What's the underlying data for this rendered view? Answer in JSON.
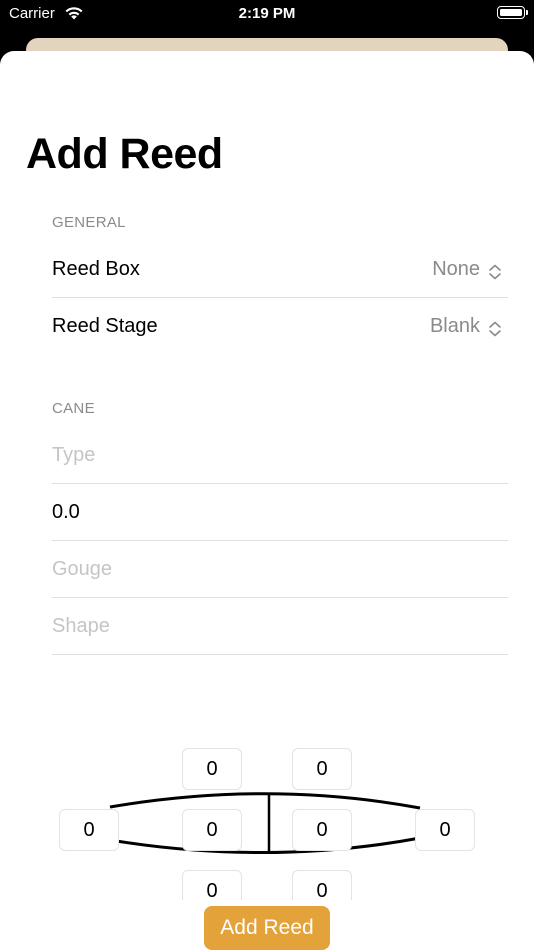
{
  "status_bar": {
    "carrier": "Carrier",
    "time": "2:19 PM"
  },
  "page": {
    "title": "Add Reed"
  },
  "general": {
    "header": "GENERAL",
    "reed_box": {
      "label": "Reed Box",
      "value": "None"
    },
    "reed_stage": {
      "label": "Reed Stage",
      "value": "Blank"
    }
  },
  "cane": {
    "header": "CANE",
    "type_placeholder": "Type",
    "diameter_value": "0.0",
    "gouge_placeholder": "Gouge",
    "shape_placeholder": "Shape"
  },
  "measurements": {
    "top_left": "0",
    "top_right": "0",
    "tip_left": "0",
    "middle_left": "0",
    "middle_right": "0",
    "tip_right": "0",
    "bottom_left": "0",
    "bottom_right": "0"
  },
  "actions": {
    "add_reed": "Add Reed"
  },
  "colors": {
    "accent": "#e3a23a",
    "behind_card": "#e2d4bd",
    "secondary_text": "#8a8a8e"
  }
}
